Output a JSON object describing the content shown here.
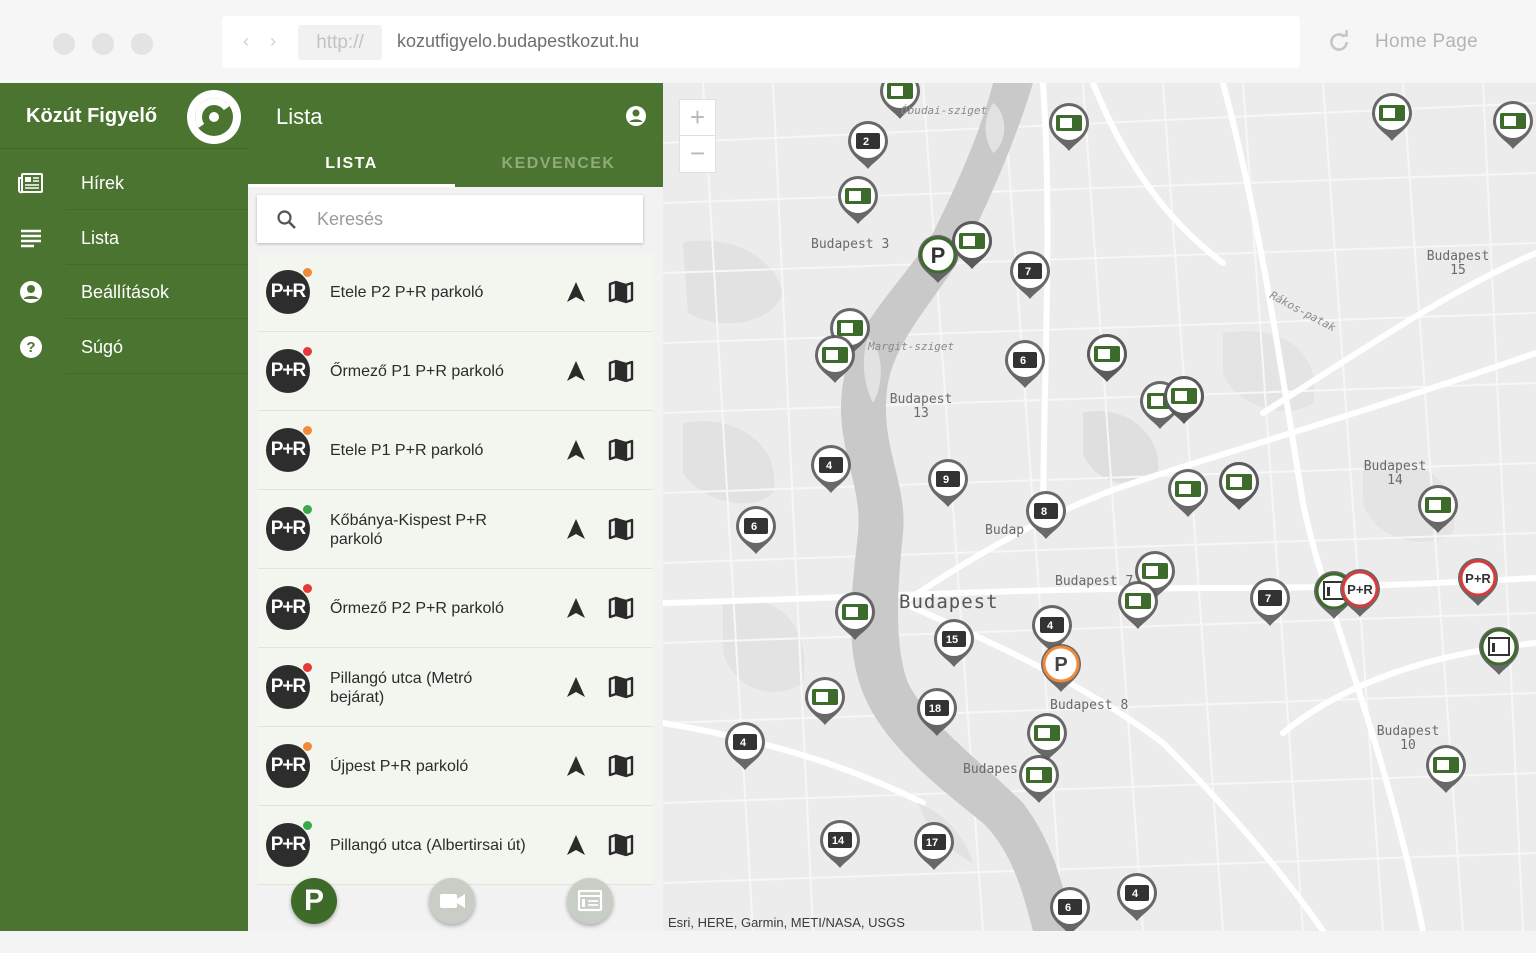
{
  "browser": {
    "protocol": "http://",
    "url": "kozutfigyelo.budapestkozut.hu",
    "home_label": "Home Page"
  },
  "sidebar": {
    "brand": "Közút Figyelő",
    "items": [
      {
        "label": "Hírek",
        "icon": "newspaper-icon"
      },
      {
        "label": "Lista",
        "icon": "list-icon"
      },
      {
        "label": "Beállítások",
        "icon": "account-icon"
      },
      {
        "label": "Súgó",
        "icon": "help-icon"
      }
    ]
  },
  "panel": {
    "title": "Lista",
    "tabs": [
      "LISTA",
      "KEDVENCEK"
    ],
    "search_placeholder": "Keresés",
    "badge_text": "P+R",
    "rows": [
      {
        "name": "Etele P2 P+R parkoló",
        "status": "#f08a3a"
      },
      {
        "name": "Őrmező P1 P+R parkoló",
        "status": "#e53935"
      },
      {
        "name": "Etele P1 P+R parkoló",
        "status": "#f08a3a"
      },
      {
        "name": "Kőbánya-Kispest P+R parkoló",
        "status": "#3aa84a"
      },
      {
        "name": "Őrmező P2 P+R parkoló",
        "status": "#e53935"
      },
      {
        "name": "Pillangó utca (Metró bejárat)",
        "status": "#e53935"
      },
      {
        "name": "Újpest P+R parkoló",
        "status": "#f08a3a"
      },
      {
        "name": "Pillangó utca (Albertirsai út)",
        "status": "#3aa84a"
      }
    ],
    "fab_parking_label": "P"
  },
  "map": {
    "attribution": "Esri, HERE, Garmin, METI/NASA, USGS",
    "labels": [
      {
        "text": "Budapest 3",
        "kind": "district"
      },
      {
        "text": "Budapest 13",
        "kind": "district"
      },
      {
        "text": "Budapest 15",
        "kind": "district"
      },
      {
        "text": "Budapest 14",
        "kind": "district"
      },
      {
        "text": "Budapest",
        "kind": "city"
      },
      {
        "text": "Budapest 8",
        "kind": "district"
      },
      {
        "text": "Budapest 10",
        "kind": "district"
      },
      {
        "text": "Budapest 7",
        "kind": "district"
      },
      {
        "text": "Budap",
        "kind": "district"
      },
      {
        "text": "Budapes",
        "kind": "district"
      },
      {
        "text": "Óbudai-sziget",
        "kind": "island"
      },
      {
        "text": "Margit-sziget",
        "kind": "island"
      },
      {
        "text": "Rákos-patak",
        "kind": "creek"
      }
    ],
    "camera_markers_single": 21,
    "camera_markers_numbered": [
      "2",
      "7",
      "6",
      "4",
      "9",
      "8",
      "6",
      "15",
      "4",
      "18",
      "4",
      "7",
      "14",
      "17",
      "4",
      "6"
    ],
    "colors": {
      "camera": "#3c6b2b",
      "numbered": "#333333",
      "pr_red": "#d83b3b",
      "parking_orange": "#f08a3a"
    }
  }
}
